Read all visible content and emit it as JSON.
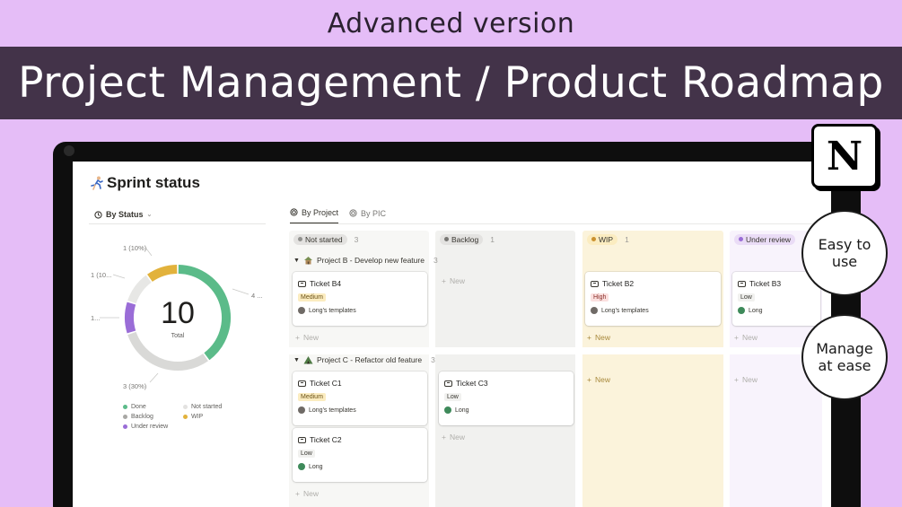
{
  "banner": {
    "subtitle": "Advanced version",
    "title": "Project Management / Product Roadmap"
  },
  "page": {
    "title": "Sprint status"
  },
  "chart_view": {
    "tab_label": "By Status",
    "total": "10",
    "total_label": "Total",
    "labels": [
      "1 (10%)",
      "1 (10...",
      "1...",
      "4 ...",
      "3 (30%)"
    ]
  },
  "chart_data": {
    "type": "pie",
    "title": "",
    "categories": [
      "Done",
      "Backlog",
      "Under review",
      "Not started",
      "WIP"
    ],
    "values": [
      4,
      3,
      1,
      1,
      1
    ],
    "colors": [
      "#5bbb89",
      "#d9d9d7",
      "#9a6dd7",
      "#e7e7e5",
      "#e2b23c"
    ],
    "legend_position": "bottom"
  },
  "legend": [
    {
      "label": "Done",
      "color": "#5bbb89"
    },
    {
      "label": "Not started",
      "color": "#e3e2e0"
    },
    {
      "label": "Backlog",
      "color": "#a8a7a4"
    },
    {
      "label": "WIP",
      "color": "#e2b23c"
    },
    {
      "label": "Under review",
      "color": "#9a6dd7"
    }
  ],
  "board": {
    "tabs": [
      {
        "label": "By Project",
        "icon": "target-icon",
        "active": true
      },
      {
        "label": "By PIC",
        "icon": "target-icon",
        "active": false
      }
    ],
    "columns": [
      {
        "label": "Not started",
        "count": "3",
        "bg": "#f7f7f5",
        "pill": "#e3e2e0",
        "dot": "#91918e"
      },
      {
        "label": "Backlog",
        "count": "1",
        "bg": "#f1f1ef",
        "pill": "#e3e2e0",
        "dot": "#787774"
      },
      {
        "label": "WIP",
        "count": "1",
        "bg": "#fbf3db",
        "pill": "#fbecc0",
        "dot": "#cb912f"
      },
      {
        "label": "Under review",
        "count": "",
        "bg": "#f8f3fc",
        "pill": "#eadcf6",
        "dot": "#9a6dd7"
      }
    ],
    "groups": [
      {
        "title": "Project B - Develop new feature",
        "count": "3",
        "icon": "hut-icon"
      },
      {
        "title": "Project C - Refactor old feature",
        "count": "3",
        "icon": "tent-icon"
      }
    ],
    "cards": [
      {
        "title": "Ticket B4",
        "tag": "Medium",
        "person": "Long's templates"
      },
      {
        "title": "Ticket B2",
        "tag": "High",
        "person": "Long's templates"
      },
      {
        "title": "Ticket B3",
        "tag": "Low",
        "person": "Long"
      },
      {
        "title": "Ticket C1",
        "tag": "Medium",
        "person": "Long's templates"
      },
      {
        "title": "Ticket C3",
        "tag": "Low",
        "person": "Long"
      },
      {
        "title": "Ticket C2",
        "tag": "Low",
        "person": "Long"
      }
    ],
    "new_label": "New"
  },
  "badges": {
    "logo": "N",
    "easy_line1": "Easy to",
    "easy_line2": "use",
    "manage_line1": "Manage",
    "manage_line2": "at ease"
  }
}
